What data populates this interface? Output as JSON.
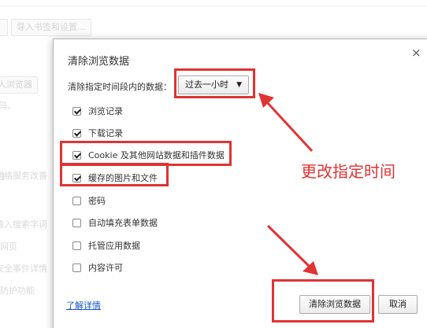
{
  "background": {
    "import_button": "导入书签和设置...",
    "browser_button": "人浏览器",
    "text_lines": [
      "码。",
      "网络服务改善",
      "输入搜索字词",
      "网页",
      "安全事件详情",
      "防护功能"
    ]
  },
  "dialog": {
    "title": "清除浏览数据",
    "close_symbol": "×",
    "range_label": "清除指定时间段内的数据：",
    "range_value": "过去一小时",
    "range_arrow": "▼",
    "options": [
      {
        "label": "浏览记录",
        "checked": true
      },
      {
        "label": "下载记录",
        "checked": true
      },
      {
        "label": "Cookie 及其他网站数据和插件数据",
        "checked": true
      },
      {
        "label": "缓存的图片和文件",
        "checked": true
      },
      {
        "label": "密码",
        "checked": false
      },
      {
        "label": "自动填充表单数据",
        "checked": false
      },
      {
        "label": "托管应用数据",
        "checked": false
      },
      {
        "label": "内容许可",
        "checked": false
      }
    ],
    "learn_more": "了解详情",
    "clear_button": "清除浏览数据",
    "cancel_button": "取消"
  },
  "annotation": {
    "text": "更改指定时间",
    "color": "#e03333"
  }
}
